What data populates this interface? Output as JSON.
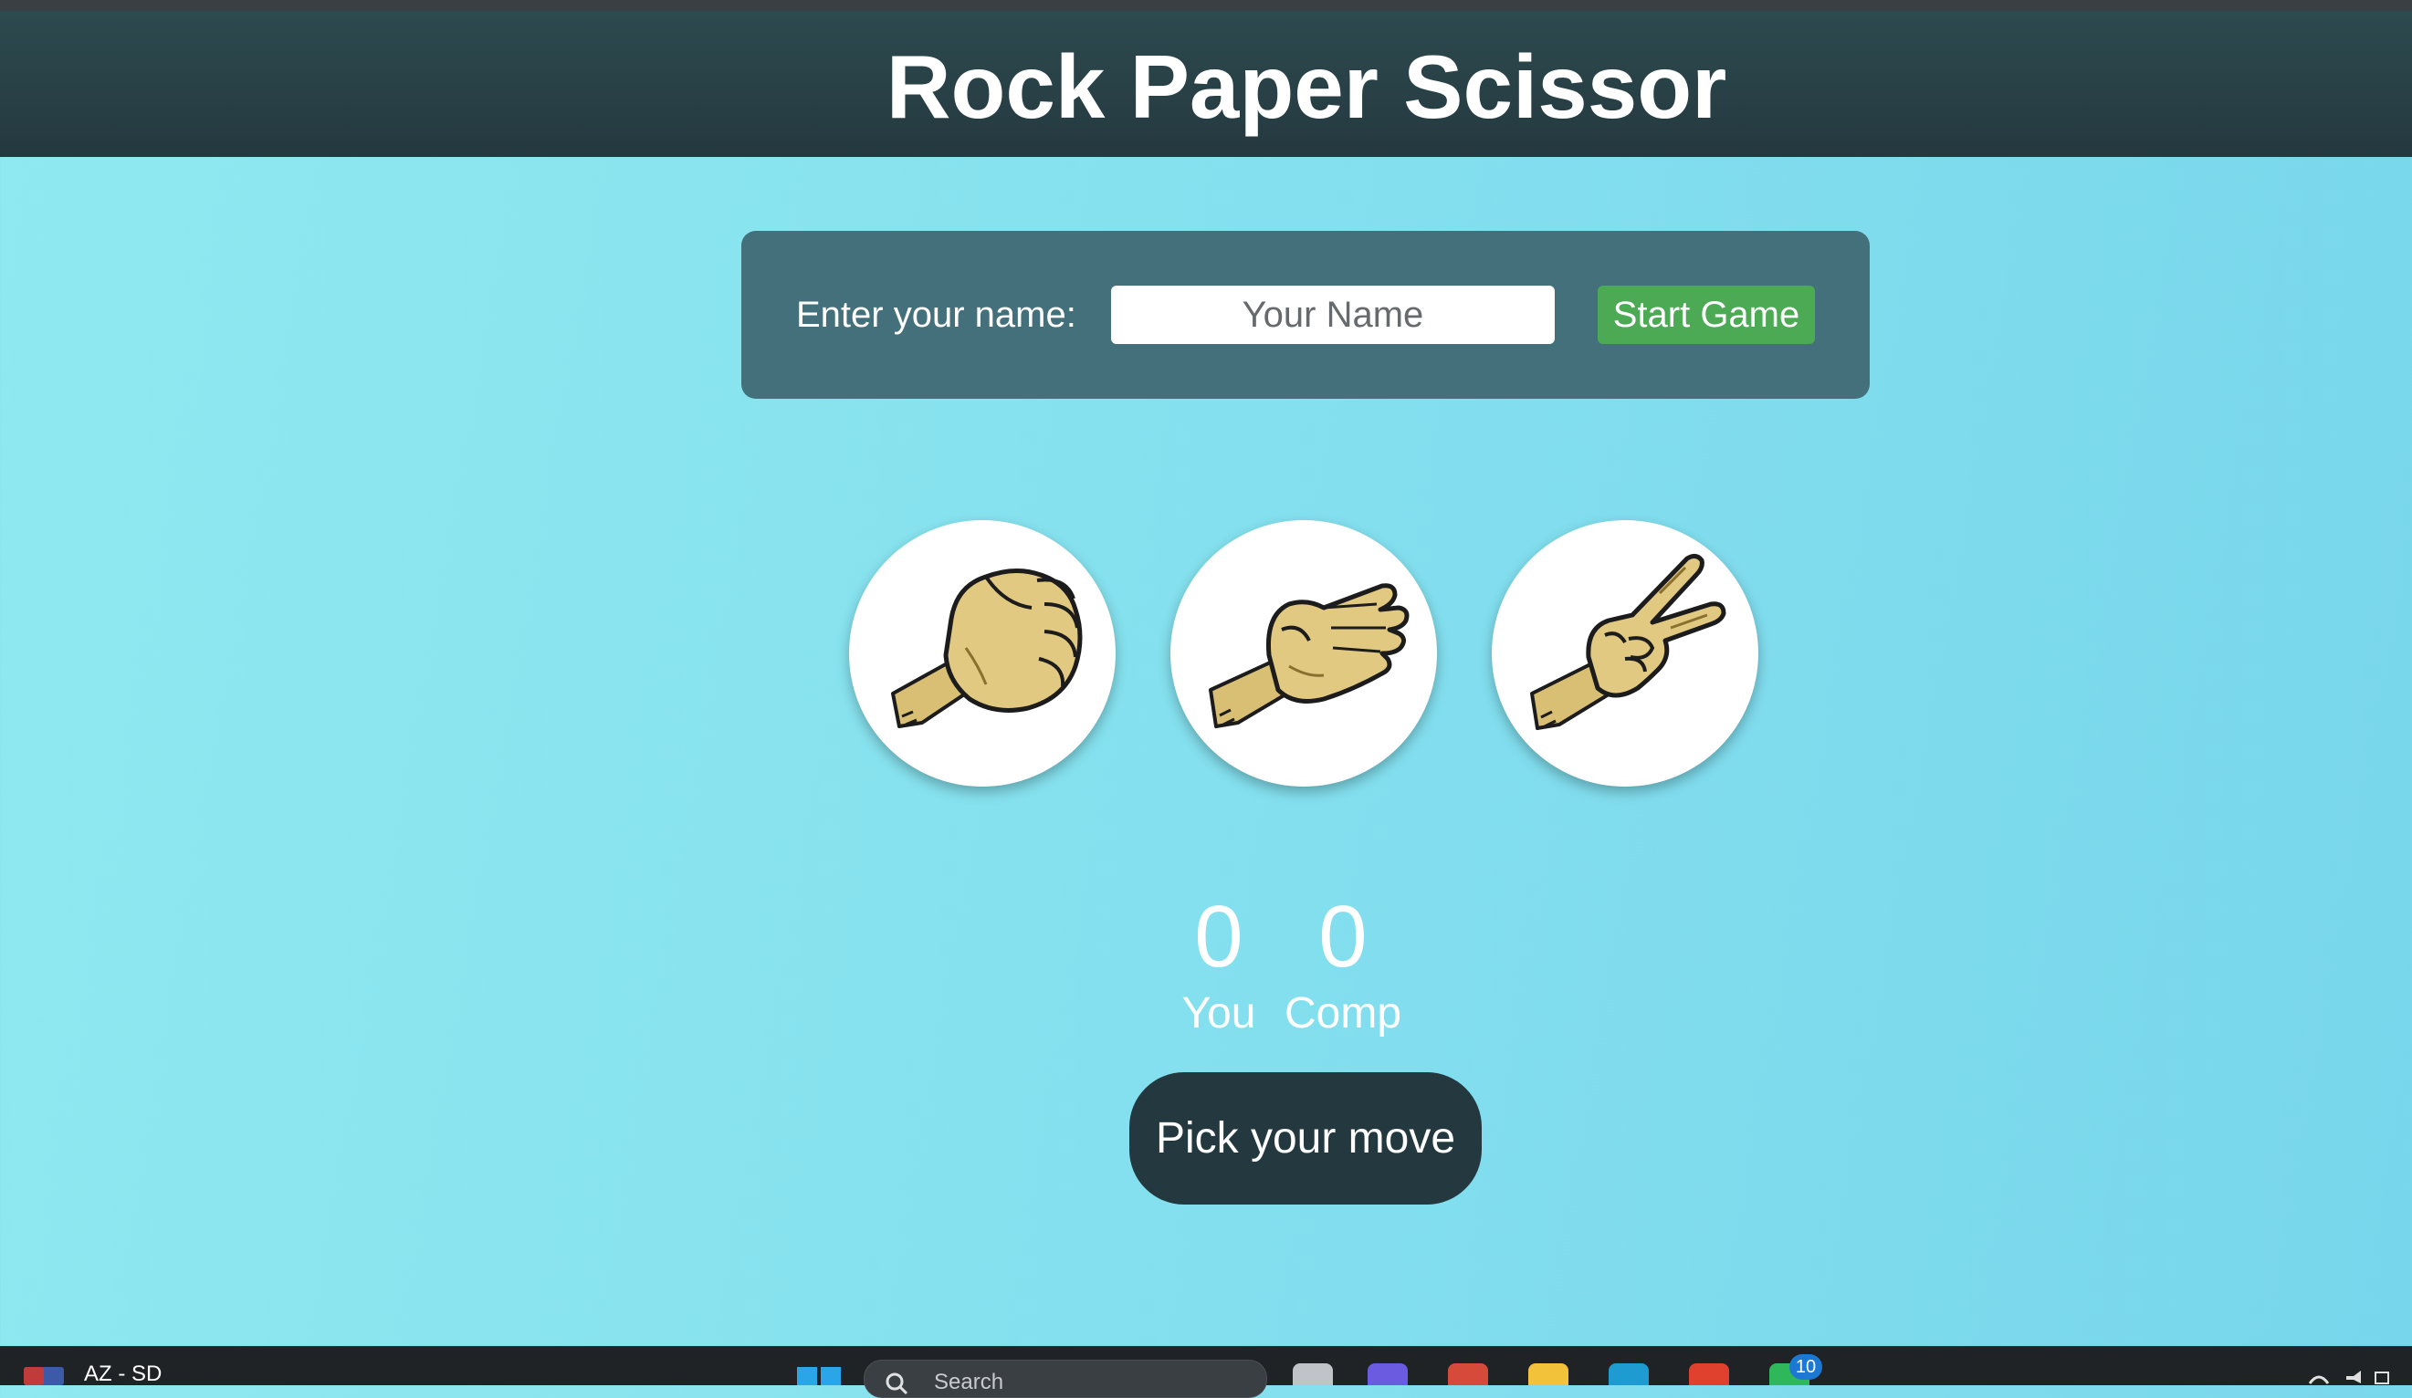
{
  "header": {
    "title": "Rock Paper Scissor"
  },
  "name_panel": {
    "label": "Enter your name:",
    "input_placeholder": "Your Name",
    "input_value": "",
    "start_button_label": "Start Game"
  },
  "choices": [
    {
      "id": "rock",
      "icon": "rock-fist-icon"
    },
    {
      "id": "paper",
      "icon": "paper-hand-icon"
    },
    {
      "id": "scissors",
      "icon": "scissors-hand-icon"
    }
  ],
  "scoreboard": {
    "user_score": "0",
    "user_label": "You",
    "comp_score": "0",
    "comp_label": "Comp"
  },
  "message": {
    "text": "Pick your move"
  },
  "taskbar": {
    "weather_text": "AZ - SD",
    "search_placeholder": "Search",
    "notification_count": "10"
  },
  "colors": {
    "header_bg": "#24393f",
    "panel_bg": "#43707a",
    "start_button": "#4caa55",
    "message_bg": "#24393f",
    "page_bg_start": "#8fe9f0",
    "page_bg_end": "#78d6ec"
  }
}
